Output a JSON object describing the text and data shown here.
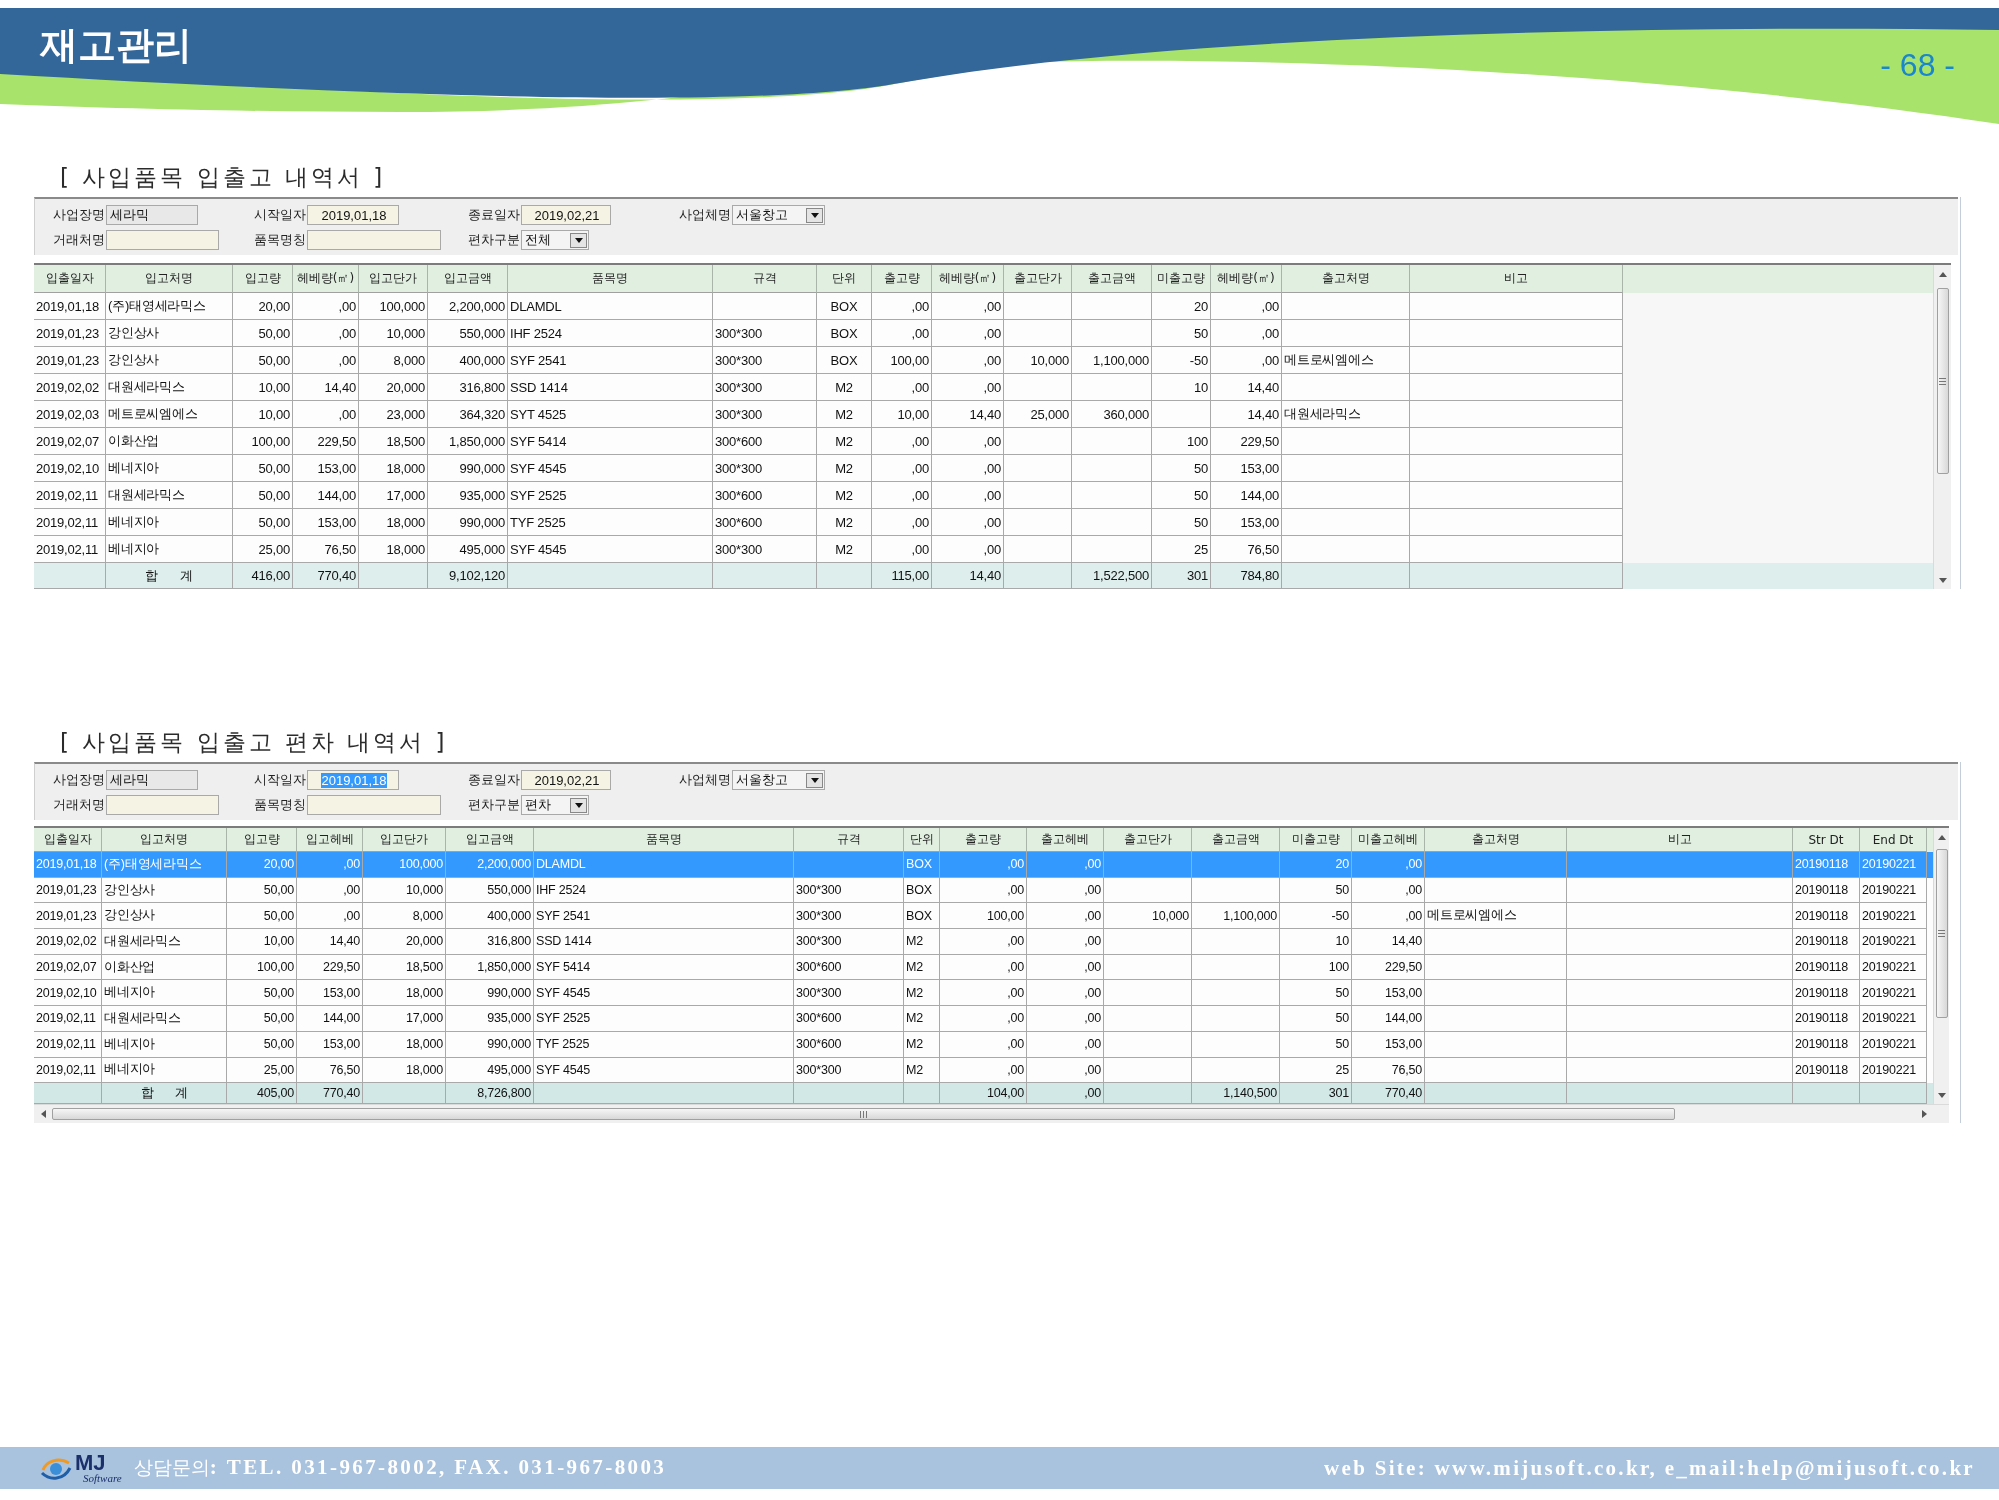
{
  "header": {
    "title": "재고관리",
    "page_number": "- 68 -"
  },
  "panels": [
    {
      "title": "[ 사입품목 입출고 내역서 ]",
      "filter_rows": [
        [
          {
            "label": "사업장명",
            "value": "세라믹",
            "kind": "text",
            "disabled": true,
            "highlighted": false
          },
          {
            "label": "시작일자",
            "value": "2019,01,18",
            "kind": "date",
            "disabled": false,
            "highlighted": false
          },
          {
            "label": "종료일자",
            "value": "2019,02,21",
            "kind": "date",
            "disabled": false,
            "highlighted": false
          },
          {
            "label": "사업체명",
            "value": "서울창고",
            "kind": "select",
            "disabled": false,
            "highlighted": false
          }
        ],
        [
          {
            "label": "거래처명",
            "kind": "text",
            "disabled": false
          },
          {
            "label": "품목명칭",
            "kind": "text",
            "disabled": false
          },
          {
            "label": "편차구분",
            "value": "전체",
            "kind": "select",
            "disabled": false,
            "highlighted": false
          }
        ]
      ],
      "table": {
        "columns": [
          "입출일자",
          "입고처명",
          "입고량",
          "헤베량(㎡)",
          "입고단가",
          "입고금액",
          "품목명",
          "규격",
          "단위",
          "출고량",
          "헤베량(㎡)",
          "출고단가",
          "출고금액",
          "미출고량",
          "헤베량(㎡)",
          "출고처명",
          "비고"
        ],
        "rows": [
          {
            "date": "2019,01,18",
            "in_vendor": "(주)태영세라믹스",
            "in_qty": "20,00",
            "in_area": ",00",
            "in_price": "100,000",
            "in_amount": "2,200,000",
            "item": "DLAMDL",
            "unit": "BOX",
            "out_qty": ",00",
            "out_area": ",00",
            "pending_qty": "20",
            "pending_area": ",00",
            "selected": false
          },
          {
            "date": "2019,01,23",
            "in_vendor": "강인상사",
            "in_qty": "50,00",
            "in_area": ",00",
            "in_price": "10,000",
            "in_amount": "550,000",
            "item": "IHF 2524",
            "spec": "300*300",
            "unit": "BOX",
            "out_qty": ",00",
            "out_area": ",00",
            "pending_qty": "50",
            "pending_area": ",00",
            "selected": false
          },
          {
            "date": "2019,01,23",
            "in_vendor": "강인상사",
            "in_qty": "50,00",
            "in_area": ",00",
            "in_price": "8,000",
            "in_amount": "400,000",
            "item": "SYF 2541",
            "spec": "300*300",
            "unit": "BOX",
            "out_qty": "100,00",
            "out_area": ",00",
            "out_price": "10,000",
            "out_amount": "1,100,000",
            "pending_qty": "-50",
            "pending_area": ",00",
            "out_vendor": "메트로씨엠에스",
            "selected": false
          },
          {
            "date": "2019,02,02",
            "in_vendor": "대원세라믹스",
            "in_qty": "10,00",
            "in_area": "14,40",
            "in_price": "20,000",
            "in_amount": "316,800",
            "item": "SSD 1414",
            "spec": "300*300",
            "unit": "M2",
            "out_qty": ",00",
            "out_area": ",00",
            "pending_qty": "10",
            "pending_area": "14,40",
            "selected": false
          },
          {
            "date": "2019,02,03",
            "in_vendor": "메트로씨엠에스",
            "in_qty": "10,00",
            "in_area": ",00",
            "in_price": "23,000",
            "in_amount": "364,320",
            "item": "SYT 4525",
            "spec": "300*300",
            "unit": "M2",
            "out_qty": "10,00",
            "out_area": "14,40",
            "out_price": "25,000",
            "out_amount": "360,000",
            "pending_area": "14,40",
            "out_vendor": "대원세라믹스",
            "selected": false
          },
          {
            "date": "2019,02,07",
            "in_vendor": "이화산업",
            "in_qty": "100,00",
            "in_area": "229,50",
            "in_price": "18,500",
            "in_amount": "1,850,000",
            "item": "SYF 5414",
            "spec": "300*600",
            "unit": "M2",
            "out_qty": ",00",
            "out_area": ",00",
            "pending_qty": "100",
            "pending_area": "229,50",
            "selected": false
          },
          {
            "date": "2019,02,10",
            "in_vendor": "베네지아",
            "in_qty": "50,00",
            "in_area": "153,00",
            "in_price": "18,000",
            "in_amount": "990,000",
            "item": "SYF 4545",
            "spec": "300*300",
            "unit": "M2",
            "out_qty": ",00",
            "out_area": ",00",
            "pending_qty": "50",
            "pending_area": "153,00",
            "selected": false
          },
          {
            "date": "2019,02,11",
            "in_vendor": "대원세라믹스",
            "in_qty": "50,00",
            "in_area": "144,00",
            "in_price": "17,000",
            "in_amount": "935,000",
            "item": "SYF 2525",
            "spec": "300*600",
            "unit": "M2",
            "out_qty": ",00",
            "out_area": ",00",
            "pending_qty": "50",
            "pending_area": "144,00",
            "selected": false
          },
          {
            "date": "2019,02,11",
            "in_vendor": "베네지아",
            "in_qty": "50,00",
            "in_area": "153,00",
            "in_price": "18,000",
            "in_amount": "990,000",
            "item": "TYF 2525",
            "spec": "300*600",
            "unit": "M2",
            "out_qty": ",00",
            "out_area": ",00",
            "pending_qty": "50",
            "pending_area": "153,00",
            "selected": false
          },
          {
            "date": "2019,02,11",
            "in_vendor": "베네지아",
            "in_qty": "25,00",
            "in_area": "76,50",
            "in_price": "18,000",
            "in_amount": "495,000",
            "item": "SYF 4545",
            "spec": "300*300",
            "unit": "M2",
            "out_qty": ",00",
            "out_area": ",00",
            "pending_qty": "25",
            "pending_area": "76,50",
            "selected": false
          }
        ],
        "total": {
          "in_vendor": "합 계",
          "in_qty": "416,00",
          "in_area": "770,40",
          "in_amount": "9,102,120",
          "out_qty": "115,00",
          "out_area": "14,40",
          "out_amount": "1,522,500",
          "pending_qty": "301",
          "pending_area": "784,80"
        }
      }
    },
    {
      "title": "[ 사입품목 입출고 편차 내역서 ]",
      "filter_rows": [
        [
          {
            "label": "사업장명",
            "value": "세라믹",
            "kind": "text",
            "disabled": true,
            "highlighted": false
          },
          {
            "label": "시작일자",
            "value": "2019,01,18",
            "kind": "date",
            "disabled": false,
            "highlighted": true
          },
          {
            "label": "종료일자",
            "value": "2019,02,21",
            "kind": "date",
            "disabled": false,
            "highlighted": false
          },
          {
            "label": "사업체명",
            "value": "서울창고",
            "kind": "select",
            "disabled": false,
            "highlighted": false
          }
        ],
        [
          {
            "label": "거래처명",
            "kind": "text",
            "disabled": false
          },
          {
            "label": "품목명칭",
            "kind": "text",
            "disabled": false
          },
          {
            "label": "편차구분",
            "value": "편차",
            "kind": "select",
            "disabled": false,
            "highlighted": false
          }
        ]
      ],
      "table": {
        "columns": [
          "입출일자",
          "입고처명",
          "입고량",
          "입고헤베",
          "입고단가",
          "입고금액",
          "품목명",
          "규격",
          "단위",
          "출고량",
          "출고헤베",
          "출고단가",
          "출고금액",
          "미출고량",
          "미출고헤베",
          "출고처명",
          "비고",
          "Str Dt",
          "End Dt"
        ],
        "rows": [
          {
            "date": "2019,01,18",
            "in_vendor": "(주)태영세라믹스",
            "in_qty": "20,00",
            "in_area": ",00",
            "in_price": "100,000",
            "in_amount": "2,200,000",
            "item": "DLAMDL",
            "unit": "BOX",
            "out_qty": ",00",
            "out_area": ",00",
            "pending_qty": "20",
            "pending_area": ",00",
            "start_date": "20190118",
            "end_date": "20190221",
            "selected": true
          },
          {
            "date": "2019,01,23",
            "in_vendor": "강인상사",
            "in_qty": "50,00",
            "in_area": ",00",
            "in_price": "10,000",
            "in_amount": "550,000",
            "item": "IHF 2524",
            "spec": "300*300",
            "unit": "BOX",
            "out_qty": ",00",
            "out_area": ",00",
            "pending_qty": "50",
            "pending_area": ",00",
            "start_date": "20190118",
            "end_date": "20190221",
            "selected": false
          },
          {
            "date": "2019,01,23",
            "in_vendor": "강인상사",
            "in_qty": "50,00",
            "in_area": ",00",
            "in_price": "8,000",
            "in_amount": "400,000",
            "item": "SYF 2541",
            "spec": "300*300",
            "unit": "BOX",
            "out_qty": "100,00",
            "out_area": ",00",
            "out_price": "10,000",
            "out_amount": "1,100,000",
            "pending_qty": "-50",
            "pending_area": ",00",
            "out_vendor": "메트로씨엠에스",
            "start_date": "20190118",
            "end_date": "20190221",
            "selected": false
          },
          {
            "date": "2019,02,02",
            "in_vendor": "대원세라믹스",
            "in_qty": "10,00",
            "in_area": "14,40",
            "in_price": "20,000",
            "in_amount": "316,800",
            "item": "SSD 1414",
            "spec": "300*300",
            "unit": "M2",
            "out_qty": ",00",
            "out_area": ",00",
            "pending_qty": "10",
            "pending_area": "14,40",
            "start_date": "20190118",
            "end_date": "20190221",
            "selected": false
          },
          {
            "date": "2019,02,07",
            "in_vendor": "이화산업",
            "in_qty": "100,00",
            "in_area": "229,50",
            "in_price": "18,500",
            "in_amount": "1,850,000",
            "item": "SYF 5414",
            "spec": "300*600",
            "unit": "M2",
            "out_qty": ",00",
            "out_area": ",00",
            "pending_qty": "100",
            "pending_area": "229,50",
            "start_date": "20190118",
            "end_date": "20190221",
            "selected": false
          },
          {
            "date": "2019,02,10",
            "in_vendor": "베네지아",
            "in_qty": "50,00",
            "in_area": "153,00",
            "in_price": "18,000",
            "in_amount": "990,000",
            "item": "SYF 4545",
            "spec": "300*300",
            "unit": "M2",
            "out_qty": ",00",
            "out_area": ",00",
            "pending_qty": "50",
            "pending_area": "153,00",
            "start_date": "20190118",
            "end_date": "20190221",
            "selected": false
          },
          {
            "date": "2019,02,11",
            "in_vendor": "대원세라믹스",
            "in_qty": "50,00",
            "in_area": "144,00",
            "in_price": "17,000",
            "in_amount": "935,000",
            "item": "SYF 2525",
            "spec": "300*600",
            "unit": "M2",
            "out_qty": ",00",
            "out_area": ",00",
            "pending_qty": "50",
            "pending_area": "144,00",
            "start_date": "20190118",
            "end_date": "20190221",
            "selected": false
          },
          {
            "date": "2019,02,11",
            "in_vendor": "베네지아",
            "in_qty": "50,00",
            "in_area": "153,00",
            "in_price": "18,000",
            "in_amount": "990,000",
            "item": "TYF 2525",
            "spec": "300*600",
            "unit": "M2",
            "out_qty": ",00",
            "out_area": ",00",
            "pending_qty": "50",
            "pending_area": "153,00",
            "start_date": "20190118",
            "end_date": "20190221",
            "selected": false
          },
          {
            "date": "2019,02,11",
            "in_vendor": "베네지아",
            "in_qty": "25,00",
            "in_area": "76,50",
            "in_price": "18,000",
            "in_amount": "495,000",
            "item": "SYF 4545",
            "spec": "300*300",
            "unit": "M2",
            "out_qty": ",00",
            "out_area": ",00",
            "pending_qty": "25",
            "pending_area": "76,50",
            "start_date": "20190118",
            "end_date": "20190221",
            "selected": false
          }
        ],
        "total": {
          "in_vendor": "합 계",
          "in_qty": "405,00",
          "in_area": "770,40",
          "in_amount": "8,726,800",
          "out_qty": "104,00",
          "out_area": ",00",
          "out_amount": "1,140,500",
          "pending_qty": "301",
          "pending_area": "770,40"
        }
      }
    }
  ],
  "footer": {
    "logo": {
      "name": "MJ",
      "tagline": "Software"
    },
    "contact": "상담문의**: TEL. 031-967-8002, FAX. 031-967-8003**",
    "website": "web Site: www.mijusoft.co.kr, e_mail:help@mijusoft.co.kr"
  }
}
